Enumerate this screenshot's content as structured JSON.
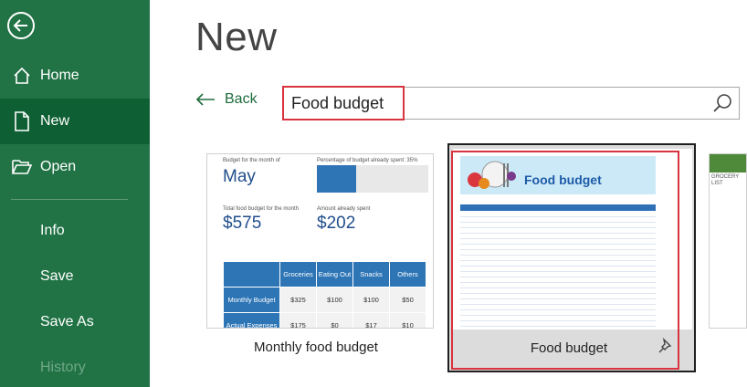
{
  "sidebar": {
    "home": "Home",
    "new": "New",
    "open": "Open",
    "info": "Info",
    "save": "Save",
    "save_as": "Save As",
    "history": "History"
  },
  "main": {
    "title": "New",
    "back": "Back",
    "search": {
      "value": "Food budget",
      "placeholder": ""
    }
  },
  "templates": [
    {
      "name": "Monthly food budget",
      "preview": {
        "budget_month_label": "Budget for the month of",
        "month": "May",
        "percentage_label": "Percentage of budget already spent:",
        "percentage_value": "35%",
        "percentage_fill": 0.35,
        "total_label": "Total food budget for the month",
        "total": "$575",
        "spent_label": "Amount already spent",
        "spent": "$202",
        "columns": [
          "Groceries",
          "Eating Out",
          "Snacks",
          "Others"
        ],
        "rows": [
          {
            "label": "Monthly Budget",
            "values": [
              "$325",
              "$100",
              "$100",
              "$50"
            ]
          },
          {
            "label": "Actual Expenses",
            "values": [
              "$175",
              "$0",
              "$17",
              "$10"
            ]
          }
        ]
      }
    },
    {
      "name": "Food budget",
      "preview": {
        "banner_title": "Food budget"
      }
    },
    {
      "name": "",
      "preview": {
        "banner_title": "GROCERY LIST"
      }
    }
  ],
  "colors": {
    "sidebar": "#217346",
    "sidebar_active": "#0f5f34",
    "accent": "#1d6b3b",
    "highlight": "#d9333f",
    "table_blue": "#2e75b6"
  }
}
